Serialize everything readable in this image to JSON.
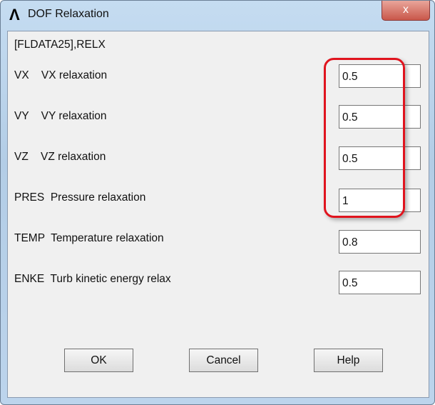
{
  "window": {
    "title": "DOF Relaxation",
    "close_label": "x"
  },
  "command": "[FLDATA25],RELX",
  "fields": [
    {
      "label": "VX    VX relaxation",
      "value": "0.5"
    },
    {
      "label": "VY    VY relaxation",
      "value": "0.5"
    },
    {
      "label": "VZ    VZ relaxation",
      "value": "0.5"
    },
    {
      "label": "PRES  Pressure relaxation",
      "value": "1"
    },
    {
      "label": "TEMP  Temperature relaxation",
      "value": "0.8"
    },
    {
      "label": "ENKE  Turb kinetic energy relax",
      "value": "0.5"
    }
  ],
  "buttons": {
    "ok": "OK",
    "cancel": "Cancel",
    "help": "Help"
  },
  "highlight_color": "#e0141e"
}
